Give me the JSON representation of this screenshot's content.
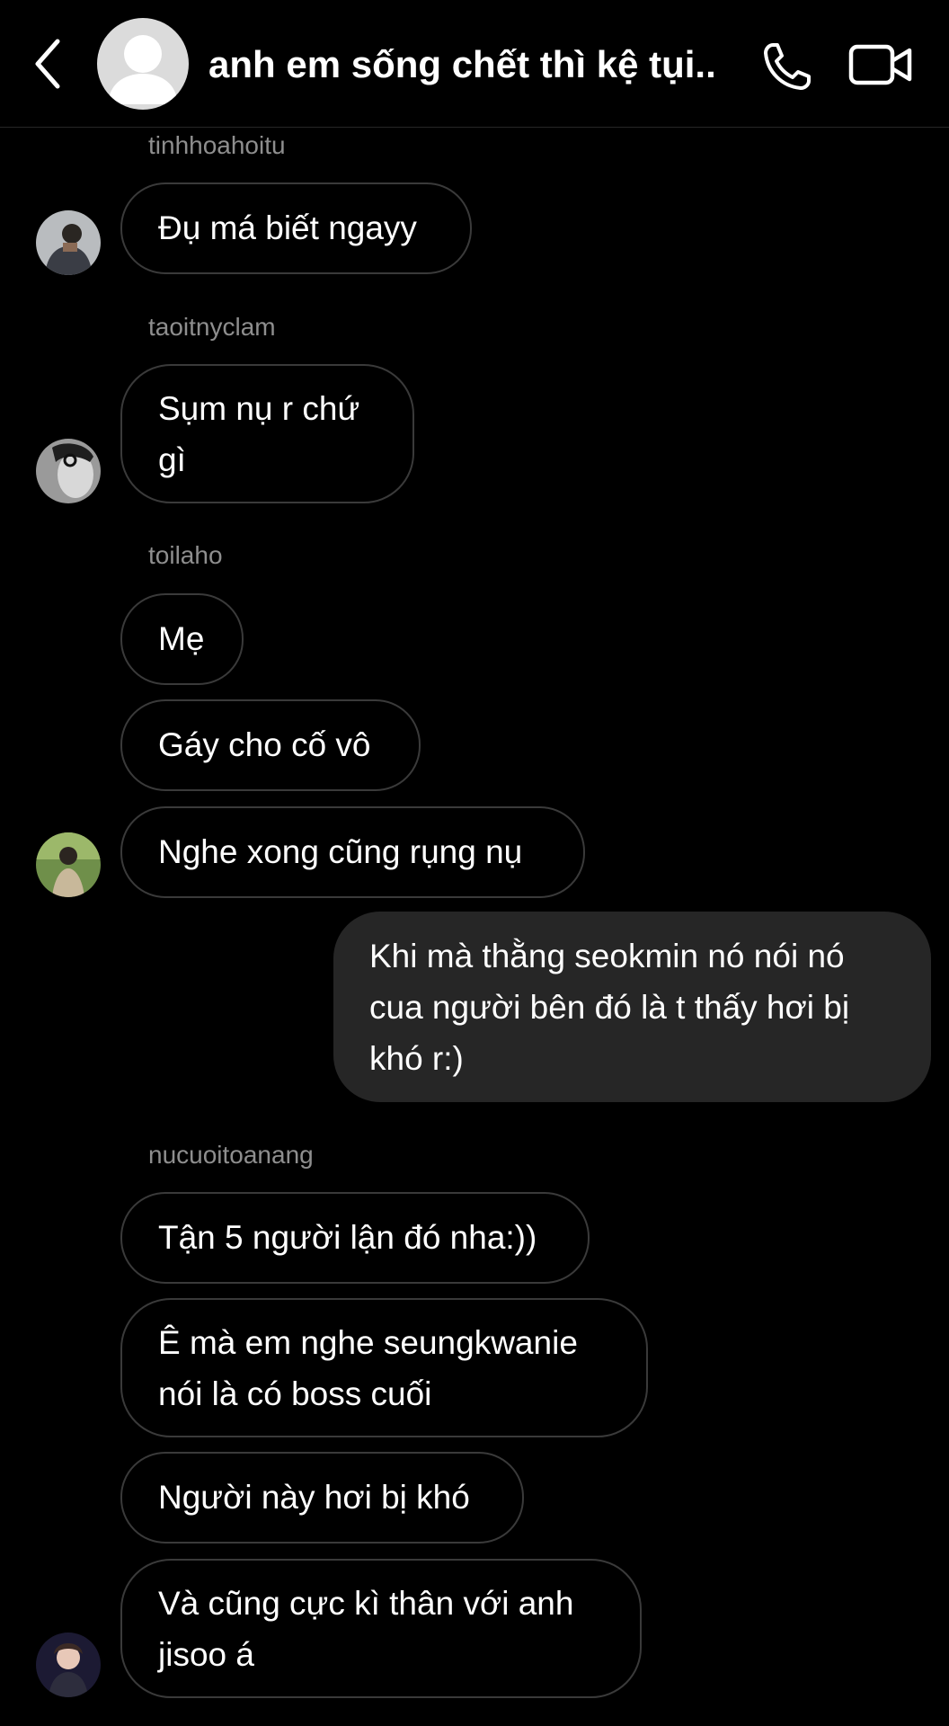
{
  "header": {
    "title": "anh em sống chết thì kệ tụi.."
  },
  "messages": {
    "u1": "tinhhoahoitu",
    "m1": "Đụ má biết ngayy",
    "u2": "taoitnyclam",
    "m2": "Sụm nụ r chứ gì",
    "u3": "toilaho",
    "m3": "Mẹ",
    "m4": "Gáy cho cố vô",
    "m5": "Nghe xong cũng rụng nụ",
    "out1": "Khi mà thằng seokmin nó nói nó cua người bên đó là t thấy hơi bị khó r:)",
    "u4": "nucuoitoanang",
    "m6": "Tận 5 người lận đó nha:))",
    "m7": "Ê mà em nghe seungkwanie nói là có boss cuối",
    "m8": "Người này hơi bị khó",
    "m9": "Và cũng cực kì thân với anh jisoo á"
  },
  "icons": {
    "back": "chevron-left-icon",
    "phone": "phone-icon",
    "video": "video-camera-icon"
  },
  "colors": {
    "background": "#000000",
    "outgoing_bubble": "#262626",
    "bubble_border": "#3a3a3a",
    "username": "#8e8e8e"
  }
}
